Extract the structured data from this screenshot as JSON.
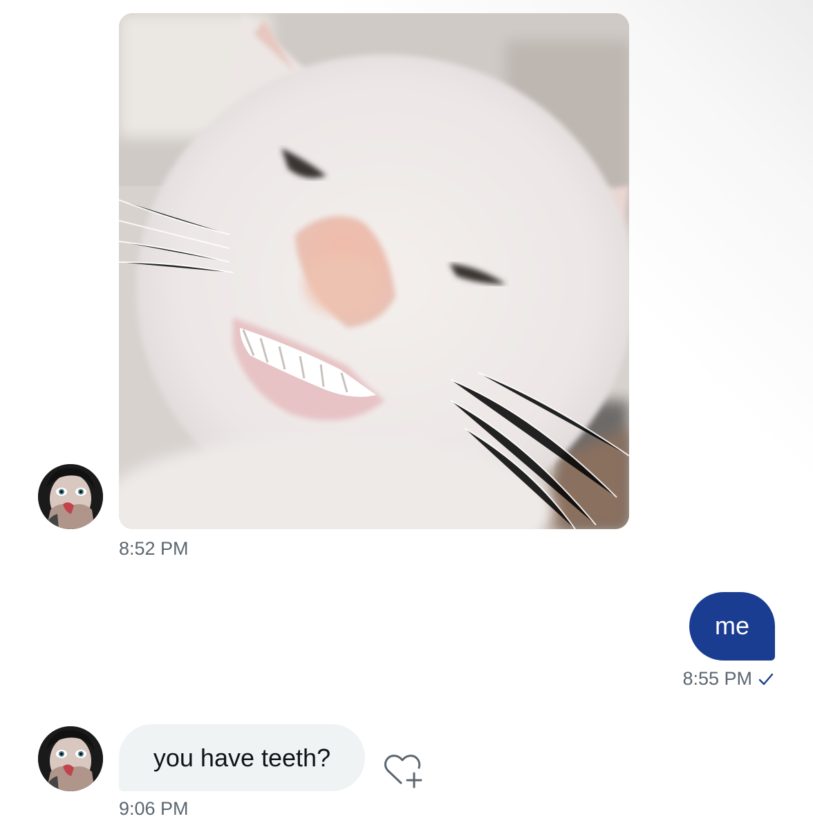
{
  "conversation": {
    "messages": [
      {
        "direction": "received",
        "kind": "image",
        "image_icon": "smiling-cat-photo",
        "time": "8:52 PM"
      },
      {
        "direction": "sent",
        "kind": "text",
        "text": "me",
        "time": "8:55 PM",
        "status_icon": "checkmark-icon"
      },
      {
        "direction": "received",
        "kind": "text",
        "text": "you have teeth?",
        "time": "9:06 PM",
        "reaction_icon": "heart-plus-icon"
      }
    ]
  },
  "colors": {
    "sent_bubble": "#1b3d91",
    "received_bubble": "#eff3f4",
    "timestamp": "#5b6670",
    "background": "#ffffff"
  }
}
